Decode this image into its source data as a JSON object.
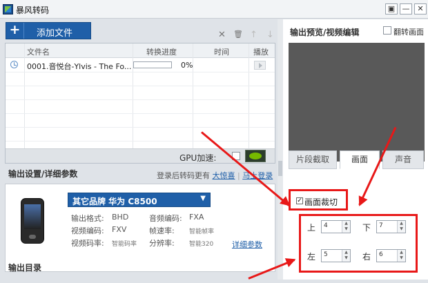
{
  "window": {
    "title": "暴风转码",
    "buttons": [
      "▣",
      "—",
      "✕"
    ]
  },
  "toolbar": {
    "add_label": "添加文件",
    "plus": "+",
    "delete_icon": "✕",
    "trash_icon": "🗑",
    "up_icon": "↑",
    "down_icon": "↓"
  },
  "filelist": {
    "columns": [
      "文件名",
      "转换进度",
      "时间",
      "播放"
    ],
    "rows": [
      {
        "name": "0001.音悦台-Ylvis - The Fo...",
        "progress_text": "0%",
        "progress": 0,
        "time": ""
      }
    ]
  },
  "gpu": {
    "label": "GPU加速:"
  },
  "output_settings": {
    "title": "输出设置/详细参数",
    "login_hint": "登录后转码更有",
    "surprise_link": "大惊喜",
    "login_link": "马上登录",
    "brand_label": "其它品牌  华为  C8500",
    "specs": [
      {
        "k": "输出格式:",
        "v": "BHD",
        "k2": "音频编码:",
        "v2": "FXA"
      },
      {
        "k": "视频编码:",
        "v": "FXV",
        "k2": "帧速率:",
        "v2": "智能帧率"
      },
      {
        "k": "视频码率:",
        "v": "智能码率",
        "k2": "分辨率:",
        "v2": "智能320"
      }
    ],
    "detail_link": "详细参数"
  },
  "output_dir": {
    "title": "输出目录"
  },
  "preview": {
    "title": "输出预览/视频编辑",
    "flip_label": "翻转画面"
  },
  "tabs": [
    "片段截取",
    "画面",
    "声音"
  ],
  "crop": {
    "label": "画面裁切",
    "checked_mark": "✓",
    "fields": [
      {
        "label": "上",
        "value": "4"
      },
      {
        "label": "下",
        "value": "7"
      },
      {
        "label": "左",
        "value": "5"
      },
      {
        "label": "右",
        "value": "6"
      }
    ]
  },
  "colors": {
    "accent": "#1f5fa8",
    "annotation": "#e81818"
  }
}
